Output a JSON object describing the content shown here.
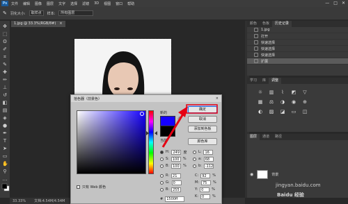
{
  "menubar": {
    "logo": "Ps",
    "items": [
      "文件",
      "编辑",
      "图像",
      "图层",
      "文字",
      "选择",
      "滤镜",
      "3D",
      "视图",
      "窗口",
      "帮助"
    ],
    "window_controls": [
      "—",
      "□",
      "✕"
    ]
  },
  "options": {
    "feather_label": "羽化大小:",
    "sample_label": "取样点",
    "sample_value": "取样点",
    "sample_field_label": "样本:",
    "sample_field_value": "所有图层"
  },
  "document": {
    "tab_title": "1.jpg @ 33.3%(RGB/8#)",
    "close": "×",
    "status_zoom": "33.33%",
    "status_doc": "文档:4.54M/4.54M"
  },
  "history_panel": {
    "tabs": [
      "颜色",
      "色板",
      "历史记录"
    ],
    "items": [
      "1.jpg",
      "打开",
      "快速选择",
      "快速选择",
      "快速选择",
      "扩展"
    ],
    "selected_index": 5
  },
  "adjust_panel": {
    "tabs": [
      "学习",
      "库",
      "调整"
    ]
  },
  "layers_panel": {
    "tabs": [
      "图层",
      "通道",
      "路径"
    ],
    "layer_name": "背景"
  },
  "color_dialog": {
    "title": "拾色器（前景色）",
    "close": "×",
    "new_label": "新的",
    "current_label": "当前",
    "ok": "确定",
    "cancel": "取消",
    "add_swatch": "添加到色板",
    "libraries": "颜色库",
    "hsb": [
      {
        "label": "H:",
        "value": "249",
        "unit": "度"
      },
      {
        "label": "S:",
        "value": "100",
        "unit": "%"
      },
      {
        "label": "B:",
        "value": "100",
        "unit": "%"
      }
    ],
    "rgb": [
      {
        "label": "R:",
        "value": "21"
      },
      {
        "label": "G:",
        "value": "0"
      },
      {
        "label": "B:",
        "value": "255"
      }
    ],
    "lab": [
      {
        "label": "L:",
        "value": "16"
      },
      {
        "label": "a:",
        "value": "68"
      },
      {
        "label": "b:",
        "value": "-112"
      }
    ],
    "cmyk": [
      {
        "label": "C:",
        "value": "92",
        "unit": "%"
      },
      {
        "label": "M:",
        "value": "75",
        "unit": "%"
      },
      {
        "label": "Y:",
        "value": "0",
        "unit": "%"
      },
      {
        "label": "K:",
        "value": "0",
        "unit": "%"
      }
    ],
    "hex_label": "#",
    "hex": "1500ff",
    "web_only": "只有 Web 颜色",
    "new_color": "#1500ff",
    "current_color": "#000000"
  },
  "watermark": {
    "text": "jingyan.baidu.com",
    "logo": "Baidu 经验"
  }
}
